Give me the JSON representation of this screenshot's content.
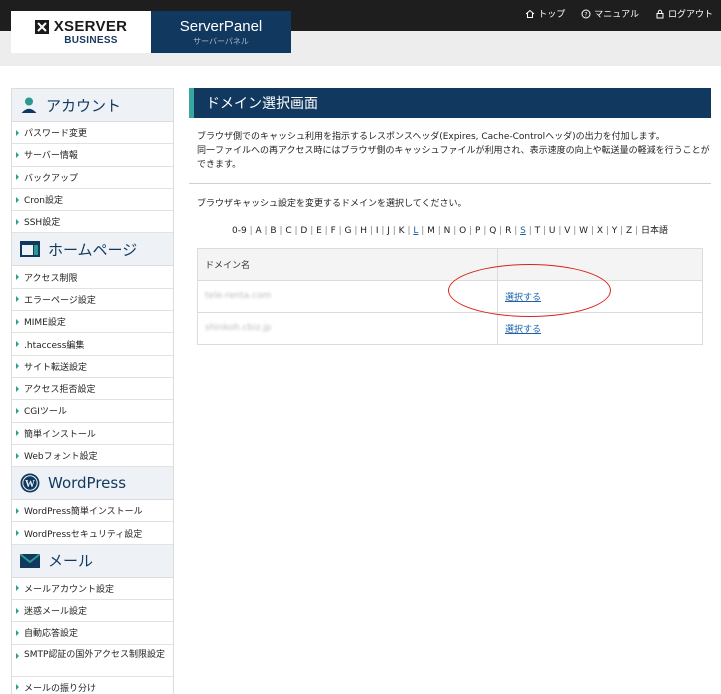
{
  "header": {
    "logo_main": "XSERVER",
    "logo_sub": "BUSINESS",
    "panel_title": "ServerPanel",
    "panel_subtitle": "サーバーパネル",
    "nav": [
      {
        "label": "トップ",
        "icon": "home-icon"
      },
      {
        "label": "マニュアル",
        "icon": "help-icon"
      },
      {
        "label": "ログアウト",
        "icon": "lock-icon"
      }
    ]
  },
  "sidebar": {
    "account": {
      "title": "アカウント",
      "items": [
        "パスワード変更",
        "サーバー情報",
        "バックアップ",
        "Cron設定",
        "SSH設定"
      ]
    },
    "homepage": {
      "title": "ホームページ",
      "items": [
        "アクセス制限",
        "エラーページ設定",
        "MIME設定",
        ".htaccess編集",
        "サイト転送設定",
        "アクセス拒否設定",
        "CGIツール",
        "簡単インストール",
        "Webフォント設定"
      ]
    },
    "wordpress": {
      "title": "WordPress",
      "items": [
        "WordPress簡単インストール",
        "WordPressセキュリティ設定"
      ]
    },
    "mail": {
      "title": "メール",
      "items": [
        "メールアカウント設定",
        "迷惑メール設定",
        "自動応答設定",
        "SMTP認証の国外アクセス制限設定",
        "メールの振り分け"
      ]
    }
  },
  "main": {
    "title": "ドメイン選択画面",
    "description_line1": "ブラウザ側でのキャッシュ利用を指示するレスポンスヘッダ(Expires, Cache-Controlヘッダ)の出力を付加します。",
    "description_line2": "同一ファイルへの再アクセス時にはブラウザ側のキャッシュファイルが利用され、表示速度の向上や転送量の軽減を行うことができます。",
    "instruction": "ブラウザキャッシュ設定を変更するドメインを選択してください。",
    "alphabet": [
      "0-9",
      "A",
      "B",
      "C",
      "D",
      "E",
      "F",
      "G",
      "H",
      "I",
      "J",
      "K",
      "L",
      "M",
      "N",
      "O",
      "P",
      "Q",
      "R",
      "S",
      "T",
      "U",
      "V",
      "W",
      "X",
      "Y",
      "Z",
      "日本語"
    ],
    "alphabet_active": [
      "L",
      "S"
    ],
    "table": {
      "header": "ドメイン名",
      "rows": [
        {
          "domain": "tele-renta.com",
          "action": "選択する"
        },
        {
          "domain": "shinkoh.cbiz.jp",
          "action": "選択する"
        }
      ]
    }
  },
  "colors": {
    "navy": "#11385f",
    "teal_accent": "#3aa6a2",
    "link": "#1a5fa8",
    "annotation": "#d9231c"
  }
}
